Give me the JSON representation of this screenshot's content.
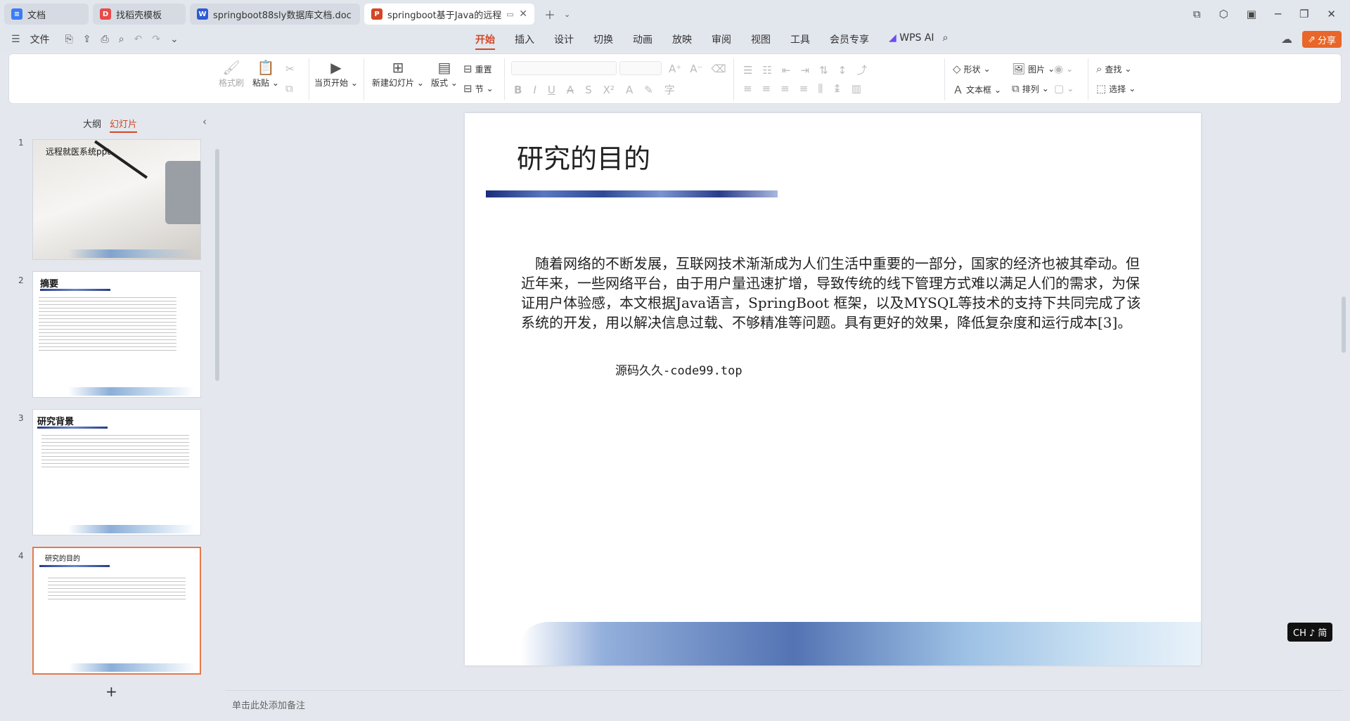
{
  "tabs": [
    {
      "label": "文档",
      "icon": "doc-icon",
      "color": "#3b7cf5",
      "active": false
    },
    {
      "label": "找稻壳模板",
      "icon": "docer-icon",
      "color": "#e84a4a",
      "active": false
    },
    {
      "label": "springboot88sly数据库文档.doc",
      "icon": "word-icon",
      "color": "#2f5bd3",
      "active": false
    },
    {
      "label": "springboot基于Java的远程",
      "icon": "ppt-icon",
      "color": "#d24726",
      "active": true
    }
  ],
  "menu": {
    "file": "文件",
    "items": [
      "开始",
      "插入",
      "设计",
      "切换",
      "动画",
      "放映",
      "审阅",
      "视图",
      "工具",
      "会员专享"
    ],
    "active": "开始",
    "wps_ai": "WPS AI",
    "share": "分享"
  },
  "ribbon": {
    "format_painter": "格式刷",
    "paste": "粘贴",
    "from_current": "当页开始",
    "new_slide": "新建幻灯片",
    "layout": "版式",
    "reset": "重置",
    "section": "节",
    "shape": "形状",
    "picture": "图片",
    "textbox": "文本框",
    "arrange": "排列",
    "find": "查找",
    "select": "选择"
  },
  "sidebar": {
    "tab_outline": "大纲",
    "tab_slides": "幻灯片",
    "slides": [
      {
        "num": "1",
        "title": "远程就医系统ppt"
      },
      {
        "num": "2",
        "title": "摘要"
      },
      {
        "num": "3",
        "title": "研究背景"
      },
      {
        "num": "4",
        "title": "研究的目的"
      }
    ],
    "add_label": "+"
  },
  "slide": {
    "title": "研究的目的",
    "body": "随着网络的不断发展，互联网技术渐渐成为人们生活中重要的一部分，国家的经济也被其牵动。但近年来，一些网络平台，由于用户量迅速扩增，导致传统的线下管理方式难以满足人们的需求，为保证用户体验感，本文根据Java语言，SpringBoot 框架，以及MYSQL等技术的支持下共同完成了该系统的开发，用以解决信息过载、不够精准等问题。具有更好的效果，降低复杂度和运行成本[3]。",
    "source": "源码久久-code99.top"
  },
  "notes_placeholder": "单击此处添加备注",
  "ime": "CH ♪ 简",
  "colors": {
    "accent": "#d24726",
    "share_bg": "#e8662a"
  }
}
